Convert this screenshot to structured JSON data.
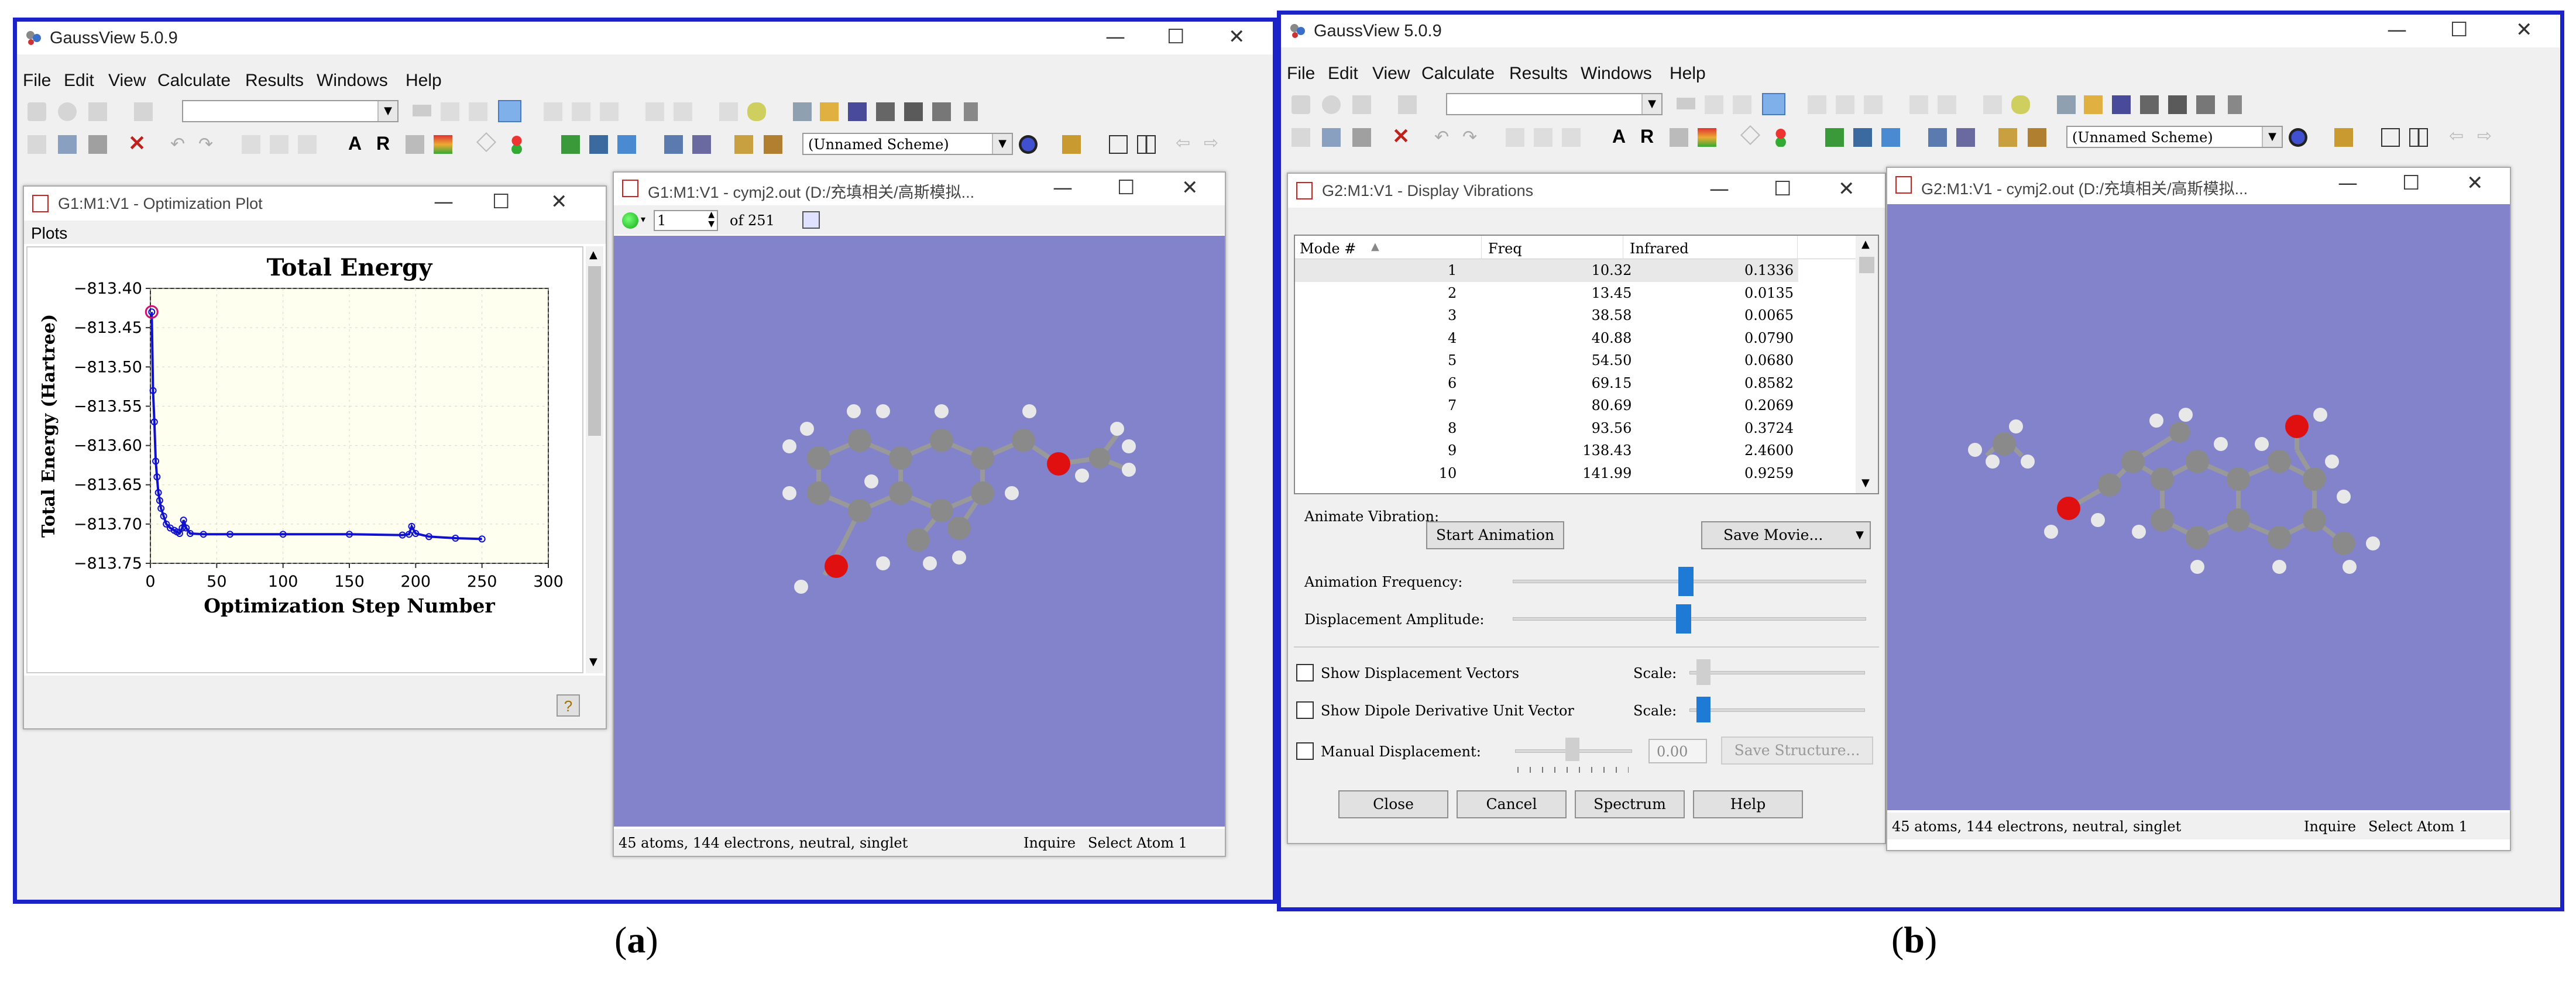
{
  "app": {
    "title": "GaussView 5.0.9",
    "menu": [
      "File",
      "Edit",
      "View",
      "Calculate",
      "Results",
      "Windows",
      "Help"
    ],
    "scheme_label": "(Unnamed Scheme)"
  },
  "panel_a": {
    "caption_open": "(",
    "caption_letter": "a",
    "caption_close": ")",
    "opt_window": {
      "title": "G1:M1:V1 - Optimization Plot",
      "menu": "Plots",
      "chart_data": {
        "type": "line",
        "title": "Total Energy",
        "xlabel": "Optimization Step Number",
        "ylabel": "Total Energy (Hartree)",
        "xlim": [
          0,
          300
        ],
        "ylim": [
          -813.75,
          -813.4
        ],
        "xticks": [
          "0",
          "50",
          "100",
          "150",
          "200",
          "250",
          "300"
        ],
        "yticks": [
          "-813.40",
          "-813.45",
          "-813.50",
          "-813.55",
          "-813.60",
          "-813.65",
          "-813.70",
          "-813.75"
        ],
        "grid": true,
        "series": [
          {
            "color": "#1010d0",
            "points": [
              [
                1,
                -813.43
              ],
              [
                2,
                -813.53
              ],
              [
                3,
                -813.57
              ],
              [
                4,
                -813.62
              ],
              [
                5,
                -813.64
              ],
              [
                6,
                -813.66
              ],
              [
                7,
                -813.67
              ],
              [
                8,
                -813.68
              ],
              [
                10,
                -813.69
              ],
              [
                12,
                -813.7
              ],
              [
                15,
                -813.705
              ],
              [
                18,
                -813.708
              ],
              [
                20,
                -813.71
              ],
              [
                22,
                -813.712
              ],
              [
                24,
                -813.705
              ],
              [
                25,
                -813.695
              ],
              [
                27,
                -813.705
              ],
              [
                30,
                -813.712
              ],
              [
                40,
                -813.713
              ],
              [
                60,
                -813.713
              ],
              [
                100,
                -813.713
              ],
              [
                150,
                -813.713
              ],
              [
                190,
                -813.714
              ],
              [
                195,
                -813.713
              ],
              [
                197,
                -813.703
              ],
              [
                200,
                -813.712
              ],
              [
                210,
                -813.716
              ],
              [
                230,
                -813.718
              ],
              [
                250,
                -813.719
              ]
            ],
            "highlight": [
              1,
              -813.43
            ]
          }
        ]
      }
    },
    "mol_window": {
      "title": "G1:M1:V1 - cymj2.out (D:/充填相关/高斯模拟...",
      "frame_value": "1",
      "frame_of": "of 251",
      "status": "45 atoms, 144 electrons, neutral, singlet",
      "status_mode": "Inquire",
      "status_select": "Select Atom 1"
    }
  },
  "panel_b": {
    "caption_open": "(",
    "caption_letter": "b",
    "caption_close": ")",
    "vib_window": {
      "title": "G2:M1:V1 - Display Vibrations",
      "columns": [
        "Mode #",
        "Freq",
        "Infrared"
      ],
      "rows": [
        [
          "1",
          "10.32",
          "0.1336"
        ],
        [
          "2",
          "13.45",
          "0.0135"
        ],
        [
          "3",
          "38.58",
          "0.0065"
        ],
        [
          "4",
          "40.88",
          "0.0790"
        ],
        [
          "5",
          "54.50",
          "0.0680"
        ],
        [
          "6",
          "69.15",
          "0.8582"
        ],
        [
          "7",
          "80.69",
          "0.2069"
        ],
        [
          "8",
          "93.56",
          "0.3724"
        ],
        [
          "9",
          "138.43",
          "2.4600"
        ],
        [
          "10",
          "141.99",
          "0.9259"
        ]
      ],
      "animate_label": "Animate Vibration:",
      "start_animation": "Start Animation",
      "save_movie": "Save Movie...",
      "anim_freq_label": "Animation Frequency:",
      "disp_amp_label": "Displacement Amplitude:",
      "show_disp_vectors": "Show Displacement Vectors",
      "show_dipole": "Show Dipole Derivative Unit Vector",
      "manual_disp": "Manual Displacement:",
      "scale_label": "Scale:",
      "manual_value": "0.00",
      "save_structure": "Save Structure...",
      "close": "Close",
      "cancel": "Cancel",
      "spectrum": "Spectrum",
      "help": "Help"
    },
    "mol_window": {
      "title": "G2:M1:V1 - cymj2.out (D:/充填相关/高斯模拟...",
      "status": "45 atoms, 144 electrons, neutral, singlet",
      "status_mode": "Inquire",
      "status_select": "Select Atom 1"
    }
  }
}
